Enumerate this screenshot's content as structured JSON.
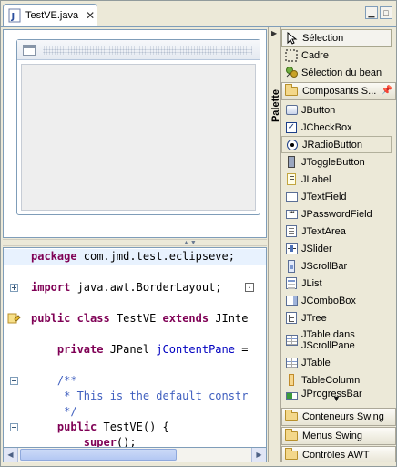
{
  "editor_tab": {
    "title": "TestVE.java",
    "close_glyph": "✕"
  },
  "source": {
    "lines": [
      {
        "tokens": [
          {
            "k": "kw",
            "t": "package"
          },
          {
            "k": "n",
            "t": " com.jmd.test.eclipseve;"
          }
        ]
      },
      {
        "tokens": [
          {
            "k": "kw",
            "t": "import"
          },
          {
            "k": "n",
            "t": " java.awt.BorderLayout;"
          }
        ]
      },
      {
        "tokens": [
          {
            "k": "kw",
            "t": "public"
          },
          {
            "k": "n",
            "t": " "
          },
          {
            "k": "kw",
            "t": "class"
          },
          {
            "k": "n",
            "t": " TestVE "
          },
          {
            "k": "kw",
            "t": "extends"
          },
          {
            "k": "n",
            "t": " JInte"
          }
        ]
      },
      {
        "tokens": [
          {
            "k": "n",
            "t": "    "
          },
          {
            "k": "kw",
            "t": "private"
          },
          {
            "k": "n",
            "t": " JPanel "
          },
          {
            "k": "field",
            "t": "jContentPane"
          },
          {
            "k": "n",
            "t": " ="
          }
        ]
      },
      {
        "tokens": [
          {
            "k": "c",
            "t": "    /**"
          }
        ]
      },
      {
        "tokens": [
          {
            "k": "c",
            "t": "     * This is the default constr"
          }
        ]
      },
      {
        "tokens": [
          {
            "k": "c",
            "t": "     */"
          }
        ]
      },
      {
        "tokens": [
          {
            "k": "n",
            "t": "    "
          },
          {
            "k": "kw",
            "t": "public"
          },
          {
            "k": "n",
            "t": " TestVE() {"
          }
        ]
      },
      {
        "tokens": [
          {
            "k": "n",
            "t": "        "
          },
          {
            "k": "kw",
            "t": "super"
          },
          {
            "k": "n",
            "t": "();"
          }
        ]
      }
    ]
  },
  "palette": {
    "title": "Palette",
    "tools": [
      {
        "label": "Sélection",
        "icon": "arrow-pointer-icon"
      },
      {
        "label": "Cadre",
        "icon": "marquee-icon"
      },
      {
        "label": "Sélection du bean",
        "icon": "bean-icon"
      }
    ],
    "open_drawer": "Composants S...",
    "components": [
      {
        "label": "JButton",
        "icon": "jbutton-icon"
      },
      {
        "label": "JCheckBox",
        "icon": "jcheckbox-icon"
      },
      {
        "label": "JRadioButton",
        "icon": "jradiobutton-icon"
      },
      {
        "label": "JToggleButton",
        "icon": "jtogglebutton-icon"
      },
      {
        "label": "JLabel",
        "icon": "jlabel-icon"
      },
      {
        "label": "JTextField",
        "icon": "jtextfield-icon"
      },
      {
        "label": "JPasswordField",
        "icon": "jpasswordfield-icon"
      },
      {
        "label": "JTextArea",
        "icon": "jtextarea-icon"
      },
      {
        "label": "JSlider",
        "icon": "jslider-icon"
      },
      {
        "label": "JScrollBar",
        "icon": "jscrollbar-icon"
      },
      {
        "label": "JList",
        "icon": "jlist-icon"
      },
      {
        "label": "JComboBox",
        "icon": "jcombobox-icon"
      },
      {
        "label": "JTree",
        "icon": "jtree-icon"
      },
      {
        "label": "JTable dans JScrollPane",
        "icon": "jtable-scrollpane-icon"
      },
      {
        "label": "JTable",
        "icon": "jtable-icon"
      },
      {
        "label": "TableColumn",
        "icon": "tablecolumn-icon"
      },
      {
        "label": "JProgressBar",
        "icon": "jprogressbar-icon"
      }
    ],
    "drawers": [
      "Conteneurs Swing",
      "Menus Swing",
      "Contrôles AWT"
    ]
  }
}
